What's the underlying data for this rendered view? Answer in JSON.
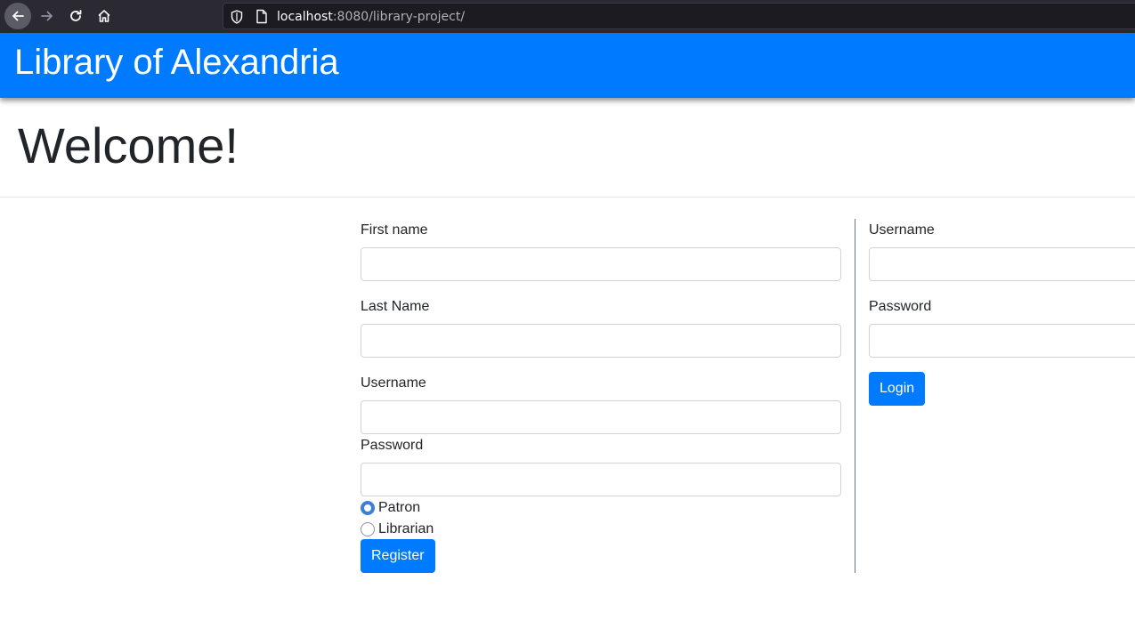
{
  "browser": {
    "url_host": "localhost",
    "url_rest": ":8080/library-project/"
  },
  "header": {
    "title": "Library of Alexandria"
  },
  "page": {
    "heading": "Welcome!"
  },
  "register": {
    "first_name_label": "First name",
    "last_name_label": "Last Name",
    "username_label": "Username",
    "password_label": "Password",
    "first_name_value": "",
    "last_name_value": "",
    "username_value": "",
    "password_value": "",
    "roles": [
      {
        "label": "Patron",
        "selected": true
      },
      {
        "label": "Librarian",
        "selected": false
      }
    ],
    "button_label": "Register"
  },
  "login": {
    "username_label": "Username",
    "password_label": "Password",
    "username_value": "",
    "password_value": "",
    "button_label": "Login"
  },
  "colors": {
    "header_bg": "#007bff",
    "button_bg": "#007bff",
    "radio_accent": "#3a7fd9"
  }
}
